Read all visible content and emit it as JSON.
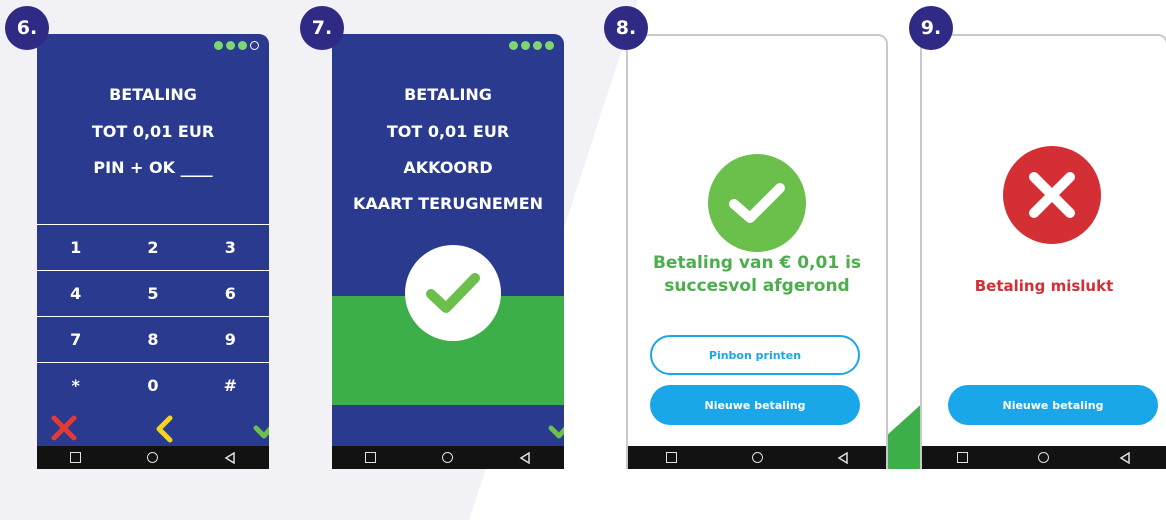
{
  "colors": {
    "navy": "#2a3b8f",
    "badge": "#2f2a83",
    "green": "#3daf4a",
    "success_green": "#6bbf4b",
    "error_red": "#d32f35",
    "accent_blue": "#1aa7ea"
  },
  "steps": [
    {
      "badge": "6.",
      "progress": {
        "filled": 3,
        "total": 4
      },
      "lines": [
        "BETALING",
        "TOT 0,01  EUR",
        "PIN + OK ____"
      ],
      "keypad": [
        [
          "1",
          "2",
          "3"
        ],
        [
          "4",
          "5",
          "6"
        ],
        [
          "7",
          "8",
          "9"
        ],
        [
          "*",
          "0",
          "#"
        ]
      ],
      "actions": [
        "cancel-x-icon",
        "back-chevron-icon",
        "confirm-check-icon"
      ]
    },
    {
      "badge": "7.",
      "progress": {
        "filled": 4,
        "total": 4
      },
      "lines": [
        "BETALING",
        "TOT 0,01  EUR",
        "AKKOORD",
        "KAART TERUGNEMEN"
      ],
      "icon": "check-circle-icon"
    },
    {
      "badge": "8.",
      "icon": "success-check-icon",
      "message_line1": "Betaling van € 0,01 is",
      "message_line2": "succesvol afgerond",
      "button_secondary": "Pinbon printen",
      "button_primary": "Nieuwe betaling"
    },
    {
      "badge": "9.",
      "icon": "error-x-icon",
      "message": "Betaling mislukt",
      "button_primary": "Nieuwe betaling"
    }
  ],
  "navbar_icons": [
    "square-icon",
    "home-circle-icon",
    "back-triangle-icon"
  ]
}
